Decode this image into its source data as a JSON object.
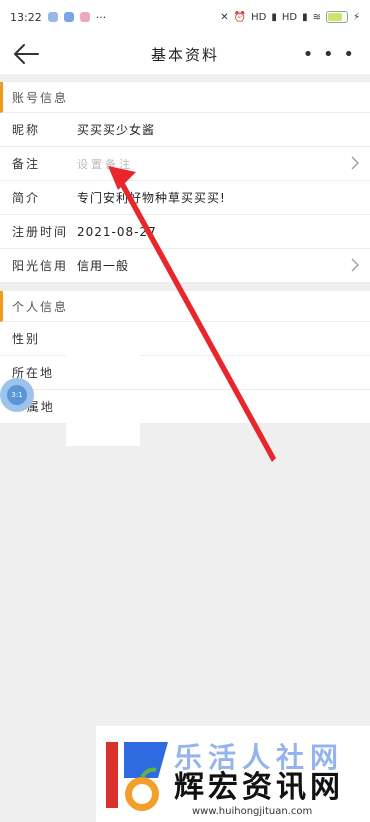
{
  "status_bar": {
    "time": "13:22",
    "dots": "···",
    "hd1": "HD",
    "hd2": "HD",
    "battery": "(6)"
  },
  "header": {
    "title": "基本资料"
  },
  "account_section": {
    "title": "账号信息",
    "rows": [
      {
        "label": "昵称",
        "value": "买买买少女酱"
      },
      {
        "label": "备注",
        "placeholder": "设置备注"
      },
      {
        "label": "简介",
        "value": "专门安利好物种草买买买!"
      },
      {
        "label": "注册时间",
        "value": "2021-08-27"
      },
      {
        "label": "阳光信用",
        "value": "信用一般"
      }
    ]
  },
  "personal_section": {
    "title": "个人信息",
    "rows": [
      {
        "label": "性别",
        "value": ""
      },
      {
        "label": "所在地",
        "value": ""
      },
      {
        "label": "IP属地",
        "value": ""
      }
    ]
  },
  "float_ball": {
    "text": "3:1"
  },
  "footer": {
    "brand_main": "辉宏资讯网",
    "brand_top": "乐活人社网",
    "url": "www.huihongjituan.com"
  },
  "colors": {
    "accent": "#f29a1b",
    "arrow": "#e8262b"
  }
}
